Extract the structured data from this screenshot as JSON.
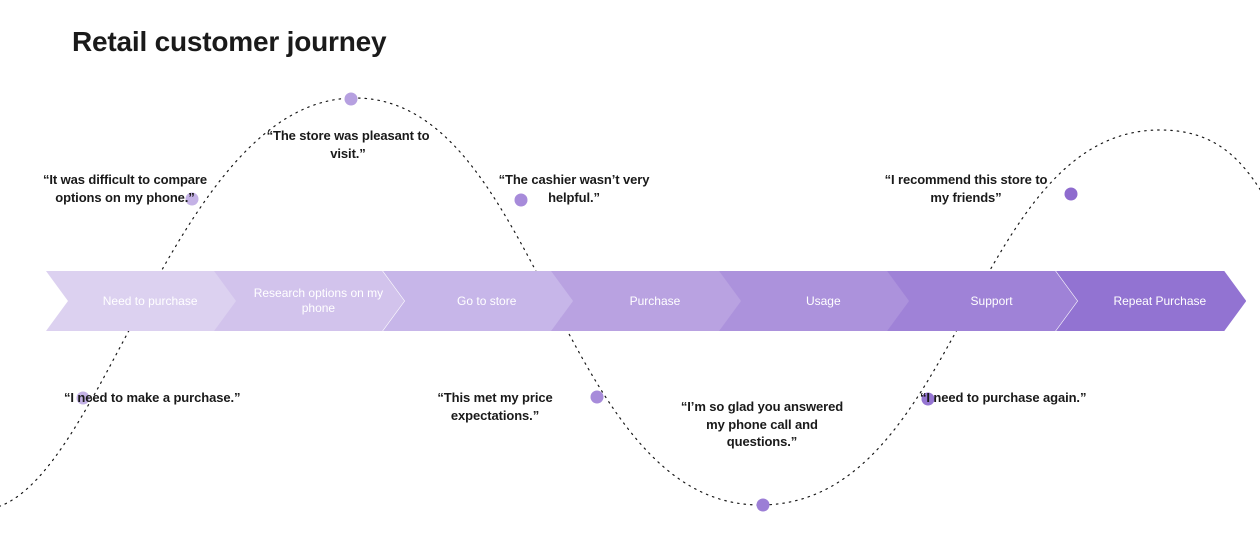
{
  "title": "Retail customer journey",
  "colors": {
    "dot": "#a78bda",
    "dotted": "#1a1a1a"
  },
  "stages": [
    {
      "label": "Need to purchase",
      "fill": "#dcd1f0"
    },
    {
      "label": "Research options on my phone",
      "fill": "#d2c3ec"
    },
    {
      "label": "Go to store",
      "fill": "#c7b6e9"
    },
    {
      "label": "Purchase",
      "fill": "#b9a2e1"
    },
    {
      "label": "Usage",
      "fill": "#ac92dc"
    },
    {
      "label": "Support",
      "fill": "#9f82d7"
    },
    {
      "label": "Repeat Purchase",
      "fill": "#9273d2"
    }
  ],
  "quotes": {
    "q0": "“I need to make a purchase.”",
    "q1": "“It was difficult to compare options on my phone.”",
    "q2": "“The store was pleasant to visit.”",
    "q3": "“This met my price expectations.”",
    "q4": "“The cashier wasn’t very helpful.”",
    "q5": "“I’m so glad you answered my phone call and questions.”",
    "q6": "“I need to purchase again.”",
    "q7": "“I recommend this store to my friends”"
  }
}
